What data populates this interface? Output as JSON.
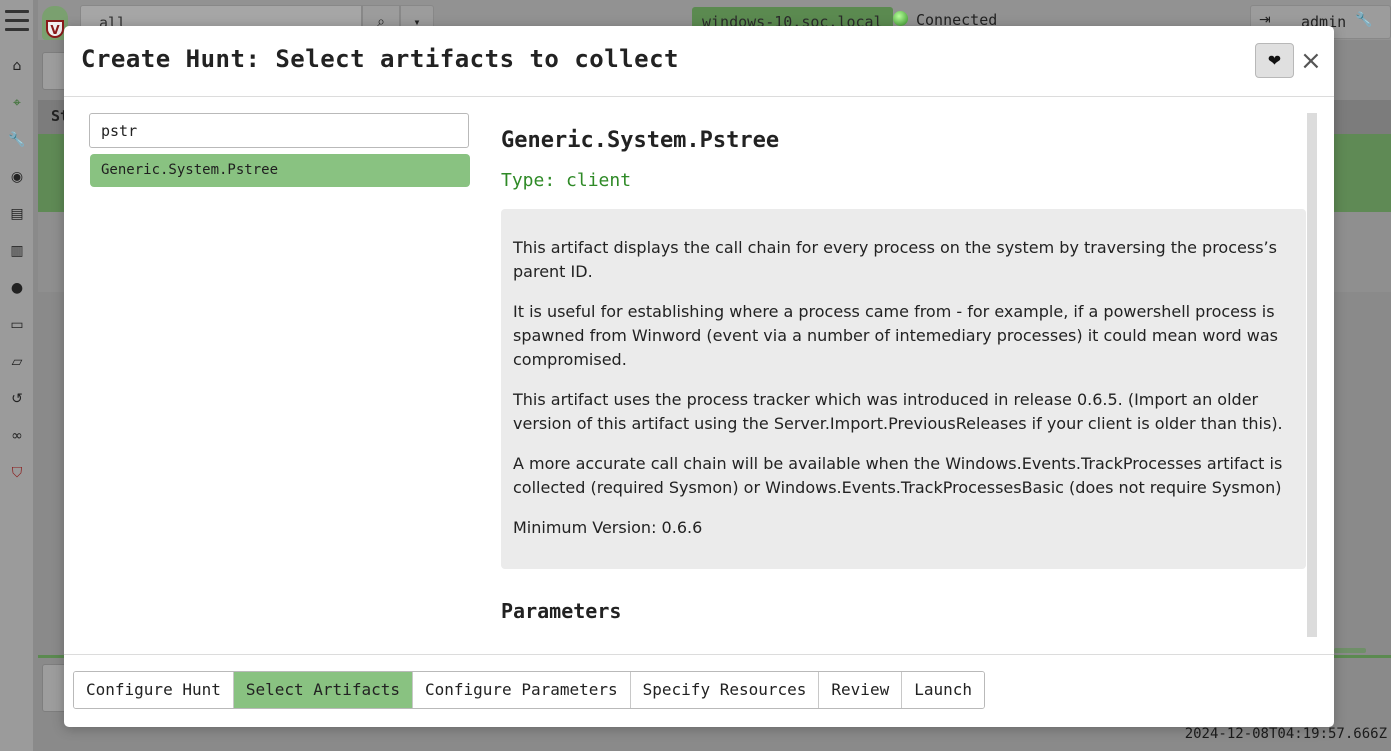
{
  "background": {
    "search_value": "all",
    "client_label": "windows-10.soc.local",
    "connection_status": "Connected",
    "username": "admin",
    "table_header_fragment": "St",
    "timestamp": "2024-12-08T04:19:57.666Z"
  },
  "modal": {
    "title": "Create Hunt: Select artifacts to collect",
    "favorite_icon": "heart-icon",
    "close_label": "×",
    "search": {
      "value": "pstr"
    },
    "results": [
      {
        "label": "Generic.System.Pstree",
        "selected": true
      }
    ],
    "artifact": {
      "name": "Generic.System.Pstree",
      "type_label": "Type: client",
      "description": [
        "This artifact displays the call chain for every process on the system by traversing the process’s parent ID.",
        "It is useful for establishing where a process came from - for example, if a powershell process is spawned from Winword (event via a number of intemediary processes) it could mean word was compromised.",
        "This artifact uses the process tracker which was introduced in release 0.6.5. (Import an older version of this artifact using the Server.Import.PreviousReleases if your client is older than this).",
        "A more accurate call chain will be available when the Windows.Events.TrackProcesses artifact is collected (required Sysmon) or Windows.Events.TrackProcessesBasic (does not require Sysmon)",
        "Minimum Version: 0.6.6"
      ],
      "parameters_heading": "Parameters"
    },
    "tabs": [
      {
        "label": "Configure Hunt",
        "active": false
      },
      {
        "label": "Select Artifacts",
        "active": true
      },
      {
        "label": "Configure Parameters",
        "active": false
      },
      {
        "label": "Specify Resources",
        "active": false
      },
      {
        "label": "Review",
        "active": false
      },
      {
        "label": "Launch",
        "active": false
      }
    ]
  },
  "colors": {
    "accent_green": "#89c281",
    "type_green": "#2f8a27"
  }
}
